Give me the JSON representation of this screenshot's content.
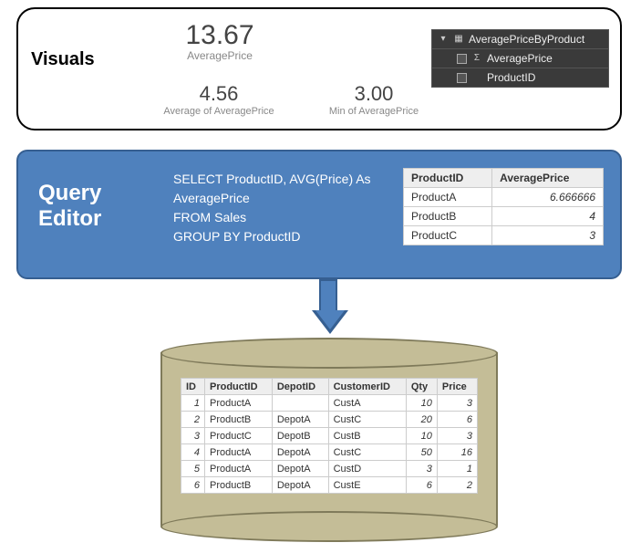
{
  "visuals": {
    "heading": "Visuals",
    "card1": {
      "value": "13.67",
      "label": "AveragePrice"
    },
    "card2": {
      "value": "4.56",
      "label": "Average of AveragePrice"
    },
    "card3": {
      "value": "3.00",
      "label": "Min of AveragePrice"
    },
    "fields": {
      "table_name": "AveragePriceByProduct",
      "rows": [
        {
          "icon": "Σ",
          "name": "AveragePrice"
        },
        {
          "icon": "",
          "name": "ProductID"
        }
      ]
    }
  },
  "query_editor": {
    "heading": "Query\nEditor",
    "sql": "SELECT ProductID, AVG(Price) As AveragePrice\nFROM Sales\nGROUP BY ProductID",
    "result": {
      "cols": [
        "ProductID",
        "AveragePrice"
      ],
      "rows": [
        {
          "ProductID": "ProductA",
          "AveragePrice": "6.666666"
        },
        {
          "ProductID": "ProductB",
          "AveragePrice": "4"
        },
        {
          "ProductID": "ProductC",
          "AveragePrice": "3"
        }
      ]
    }
  },
  "source_table": {
    "cols": [
      "ID",
      "ProductID",
      "DepotID",
      "CustomerID",
      "Qty",
      "Price"
    ],
    "rows": [
      {
        "ID": "1",
        "ProductID": "ProductA",
        "DepotID": "",
        "CustomerID": "CustA",
        "Qty": "10",
        "Price": "3"
      },
      {
        "ID": "2",
        "ProductID": "ProductB",
        "DepotID": "DepotA",
        "CustomerID": "CustC",
        "Qty": "20",
        "Price": "6"
      },
      {
        "ID": "3",
        "ProductID": "ProductC",
        "DepotID": "DepotB",
        "CustomerID": "CustB",
        "Qty": "10",
        "Price": "3"
      },
      {
        "ID": "4",
        "ProductID": "ProductA",
        "DepotID": "DepotA",
        "CustomerID": "CustC",
        "Qty": "50",
        "Price": "16"
      },
      {
        "ID": "5",
        "ProductID": "ProductA",
        "DepotID": "DepotA",
        "CustomerID": "CustD",
        "Qty": "3",
        "Price": "1"
      },
      {
        "ID": "6",
        "ProductID": "ProductB",
        "DepotID": "DepotA",
        "CustomerID": "CustE",
        "Qty": "6",
        "Price": "2"
      }
    ]
  },
  "chart_data": [
    {
      "type": "table",
      "title": "Query result",
      "columns": [
        "ProductID",
        "AveragePrice"
      ],
      "rows": [
        [
          "ProductA",
          6.666666
        ],
        [
          "ProductB",
          4
        ],
        [
          "ProductC",
          3
        ]
      ]
    },
    {
      "type": "table",
      "title": "Sales source",
      "columns": [
        "ID",
        "ProductID",
        "DepotID",
        "CustomerID",
        "Qty",
        "Price"
      ],
      "rows": [
        [
          1,
          "ProductA",
          "",
          "CustA",
          10,
          3
        ],
        [
          2,
          "ProductB",
          "DepotA",
          "CustC",
          20,
          6
        ],
        [
          3,
          "ProductC",
          "DepotB",
          "CustB",
          10,
          3
        ],
        [
          4,
          "ProductA",
          "DepotA",
          "CustC",
          50,
          16
        ],
        [
          5,
          "ProductA",
          "DepotA",
          "CustD",
          3,
          1
        ],
        [
          6,
          "ProductB",
          "DepotA",
          "CustE",
          6,
          2
        ]
      ]
    }
  ]
}
